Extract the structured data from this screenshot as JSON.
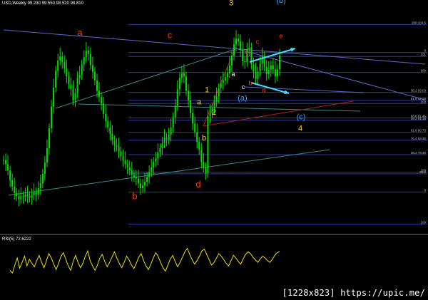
{
  "header": {
    "title": "USD,Weekly  99.230 99.550 98.520 98.810"
  },
  "rsi": {
    "title": "RSI(5) 72.6222"
  },
  "watermark": "[1228x823] https://upic.me/",
  "colors": {
    "background": "#000000",
    "candle": "#00e000",
    "rsi_line": "#f0e000",
    "hline": "#2a3aa8",
    "trend": "#5a6ac8",
    "channel": "#3a8a8a",
    "red_trend": "#b02020",
    "wave_red": "#ff3a00",
    "wave_yellow": "#ffd020",
    "wave_cyan": "#40a0ff",
    "arrow": "#40e0ff"
  },
  "fib_labels": [
    {
      "price": 104.5,
      "text": "200 104.5"
    },
    {
      "price": 101.0,
      "text": "0"
    },
    {
      "price": 100.5,
      "text": "101"
    },
    {
      "price": 98.5,
      "text": "100"
    },
    {
      "price": 96.0,
      "text": "38.2 93.03"
    },
    {
      "price": 95.0,
      "text": "61.8 92.29"
    },
    {
      "price": 94.6,
      "text": "100"
    },
    {
      "price": 92.8,
      "text": "88.6 91.46"
    },
    {
      "price": 92.5,
      "text": "38.2 91.38"
    },
    {
      "price": 91.0,
      "text": "61.8 90.73"
    },
    {
      "price": 90.0,
      "text": "76.4 83.30"
    },
    {
      "price": 88.2,
      "text": "38.2 78.30"
    },
    {
      "price": 86.0,
      "text": "100"
    },
    {
      "price": 85.8,
      "text": "61.8"
    },
    {
      "price": 83.5,
      "text": "0"
    },
    {
      "price": 79.5,
      "text": "100"
    }
  ],
  "wave_labels": [
    {
      "text": "a",
      "color": "red",
      "x": 112,
      "price": 103.1
    },
    {
      "text": "b",
      "color": "red",
      "x": 189,
      "price": 82.6
    },
    {
      "text": "c",
      "color": "red",
      "x": 238,
      "price": 102.8
    },
    {
      "text": "d",
      "color": "red",
      "x": 278,
      "price": 84.1
    },
    {
      "text": "3",
      "color": "yellow",
      "x": 324,
      "price": 106.9
    },
    {
      "text": "1",
      "color": "yellow",
      "x": 290,
      "price": 96.0
    },
    {
      "text": "2",
      "color": "yellow",
      "x": 300,
      "price": 93.2
    },
    {
      "text": "a",
      "color": "yellow",
      "x": 279,
      "price": 94.5
    },
    {
      "text": "b",
      "color": "yellow",
      "x": 286,
      "price": 90.0
    },
    {
      "text": "a",
      "color": "white",
      "x": 327,
      "price": 98.0
    },
    {
      "text": "c",
      "color": "white",
      "x": 341,
      "price": 96.4
    },
    {
      "text": "4",
      "color": "yellow",
      "x": 421,
      "price": 91.2
    },
    {
      "text": "(b)",
      "color": "cyan",
      "x": 394,
      "price": 107.2
    },
    {
      "text": "(a)",
      "color": "cyan",
      "x": 340,
      "price": 95.0
    },
    {
      "text": "(c)",
      "color": "cyan",
      "x": 422,
      "price": 92.6
    },
    {
      "text": "a",
      "color": "red",
      "x": 345,
      "price": 100.8
    },
    {
      "text": "b",
      "color": "red",
      "x": 351,
      "price": 96.9
    },
    {
      "text": "c",
      "color": "red",
      "x": 361,
      "price": 102.1
    },
    {
      "text": "d",
      "color": "red",
      "x": 370,
      "price": 96.0
    },
    {
      "text": "e",
      "color": "red",
      "x": 394,
      "price": 102.8
    }
  ],
  "chart_data": {
    "type": "line",
    "instrument": "USD",
    "timeframe": "Weekly",
    "series": [
      {
        "values": [
          87.5,
          87.0,
          86.2,
          85.0,
          84.2,
          83.4,
          83.0,
          82.6,
          83.0,
          82.9,
          83.2,
          83.0,
          82.8,
          83.1,
          83.5,
          83.2,
          84.0,
          84.6,
          85.8,
          87.2,
          89.0,
          91.5,
          94.2,
          96.6,
          98.7,
          100.0,
          100.5,
          99.8,
          99.0,
          98.0,
          97.0,
          96.4,
          95.0,
          95.9,
          97.8,
          98.2,
          99.5,
          100.4,
          101.2,
          100.8,
          99.4,
          98.6,
          97.5,
          96.2,
          95.4,
          94.6,
          93.3,
          92.4,
          91.6,
          90.8,
          90.0,
          89.4,
          89.2,
          88.6,
          88.0,
          87.5,
          87.0,
          86.6,
          86.2,
          85.7,
          85.4,
          85.2,
          84.6,
          84.0,
          84.3,
          84.8,
          85.4,
          86.0,
          86.6,
          87.3,
          87.7,
          88.5,
          89.0,
          89.6,
          90.3,
          90.1,
          90.7,
          91.6,
          92.9,
          94.3,
          96.4,
          97.8,
          98.4,
          98.0,
          96.2,
          95.0,
          93.4,
          92.1,
          91.0,
          89.8,
          88.8,
          87.3,
          86.6,
          85.9,
          93.0,
          93.4,
          94.0,
          94.8,
          95.5,
          96.5,
          97.2,
          97.5,
          97.9,
          98.4,
          99.4,
          100.6,
          102.0,
          102.7,
          102.4,
          101.3,
          99.9,
          99.8,
          101.4,
          101.6,
          99.5,
          98.6,
          97.7,
          98.6,
          99.6,
          100.5,
          99.2,
          98.3,
          98.8,
          99.4,
          98.9,
          98.0,
          98.9,
          100.6
        ]
      }
    ],
    "ylim": [
      79,
      106.5
    ],
    "annotations": [
      "Elliott wave counts a-b-c-d, 1-2-3-4, (a)(b)(c)"
    ]
  },
  "rsi_data": {
    "name": "RSI(5)",
    "last": 72.6222,
    "ylim": [
      0,
      100
    ],
    "values": [
      30,
      24,
      42,
      58,
      35,
      48,
      62,
      40,
      55,
      46,
      38,
      52,
      64,
      48,
      36,
      52,
      68,
      58,
      44,
      32,
      46,
      62,
      70,
      55,
      40,
      30,
      50,
      64,
      48,
      36,
      46,
      62,
      74,
      52,
      40,
      30,
      42,
      58,
      66,
      50,
      38,
      48,
      60,
      72,
      58,
      46,
      36,
      48,
      62,
      54,
      42,
      34,
      46,
      60,
      68,
      52,
      40,
      32,
      44,
      58,
      70,
      62,
      48,
      36,
      28,
      42,
      56,
      64,
      50,
      38,
      48,
      60,
      72,
      80,
      66,
      54,
      44,
      52,
      62,
      74,
      78,
      66,
      54,
      42,
      48,
      58,
      68,
      62,
      54,
      46,
      40,
      52,
      64,
      58,
      50,
      44,
      56,
      66,
      72,
      68,
      60,
      54,
      48,
      56,
      62,
      58,
      52,
      48,
      55,
      64,
      70,
      72.6
    ]
  }
}
